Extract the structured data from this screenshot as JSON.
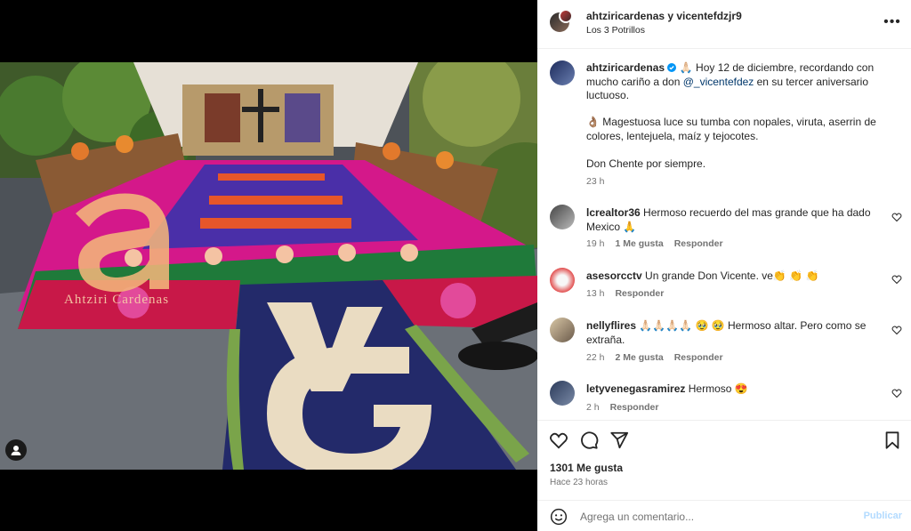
{
  "post": {
    "header": {
      "usernames": "ahtziricardenas y vicentefdzjr9",
      "subtitle": "Los 3 Potrillos",
      "more_icon": "more-horizontal-icon"
    },
    "media": {
      "watermark_text": "Ahtziri Cardenas",
      "tag_icon": "user-tag-icon"
    },
    "caption": {
      "username": "ahtziricardenas",
      "verified_icon": "verified-badge-icon",
      "emoji_1": "🙏🏻",
      "text_1": " Hoy 12 de diciembre, recordando con mucho cariño a don ",
      "mention": "@_vicentefdez",
      "text_2": " en su tercer aniversario luctuoso.",
      "paragraph_2_emoji": "👌🏽",
      "paragraph_2": " Magestuosa luce su tumba con nopales, viruta, aserrin de colores, lentejuela, maíz y tejocotes.",
      "paragraph_3": "Don Chente por siempre.",
      "time": "23 h"
    },
    "comments": [
      {
        "username": "lcrealtor36",
        "text": " Hermoso recuerdo del mas grande que ha dado Mexico 🙏",
        "time": "19 h",
        "likes": "1 Me gusta",
        "reply": "Responder"
      },
      {
        "username": "asesorcctv",
        "text": " Un grande Don Vicente. ve👏 👏 👏",
        "time": "13 h",
        "likes": "",
        "reply": "Responder"
      },
      {
        "username": "nellyflires",
        "text": " 🙏🏻🙏🏻🙏🏻🙏🏻 🥹 🥹 Hermoso altar. Pero como se extraña.",
        "time": "22 h",
        "likes": "2 Me gusta",
        "reply": "Responder"
      },
      {
        "username": "letyvenegasramirez",
        "text": " Hermoso 😍",
        "time": "2 h",
        "likes": "",
        "reply": "Responder"
      }
    ],
    "actions": {
      "like_icon": "heart-icon",
      "comment_icon": "comment-icon",
      "share_icon": "share-icon",
      "save_icon": "bookmark-icon"
    },
    "likes_count": "1301 Me gusta",
    "posted_ago": "Hace 23 horas",
    "add_comment": {
      "emoji_icon": "emoji-icon",
      "placeholder": "Agrega un comentario...",
      "publish_label": "Publicar"
    }
  },
  "colors": {
    "link": "#00376b",
    "muted": "#737373",
    "publish_disabled": "#b3dbff",
    "verified": "#0095f6"
  }
}
